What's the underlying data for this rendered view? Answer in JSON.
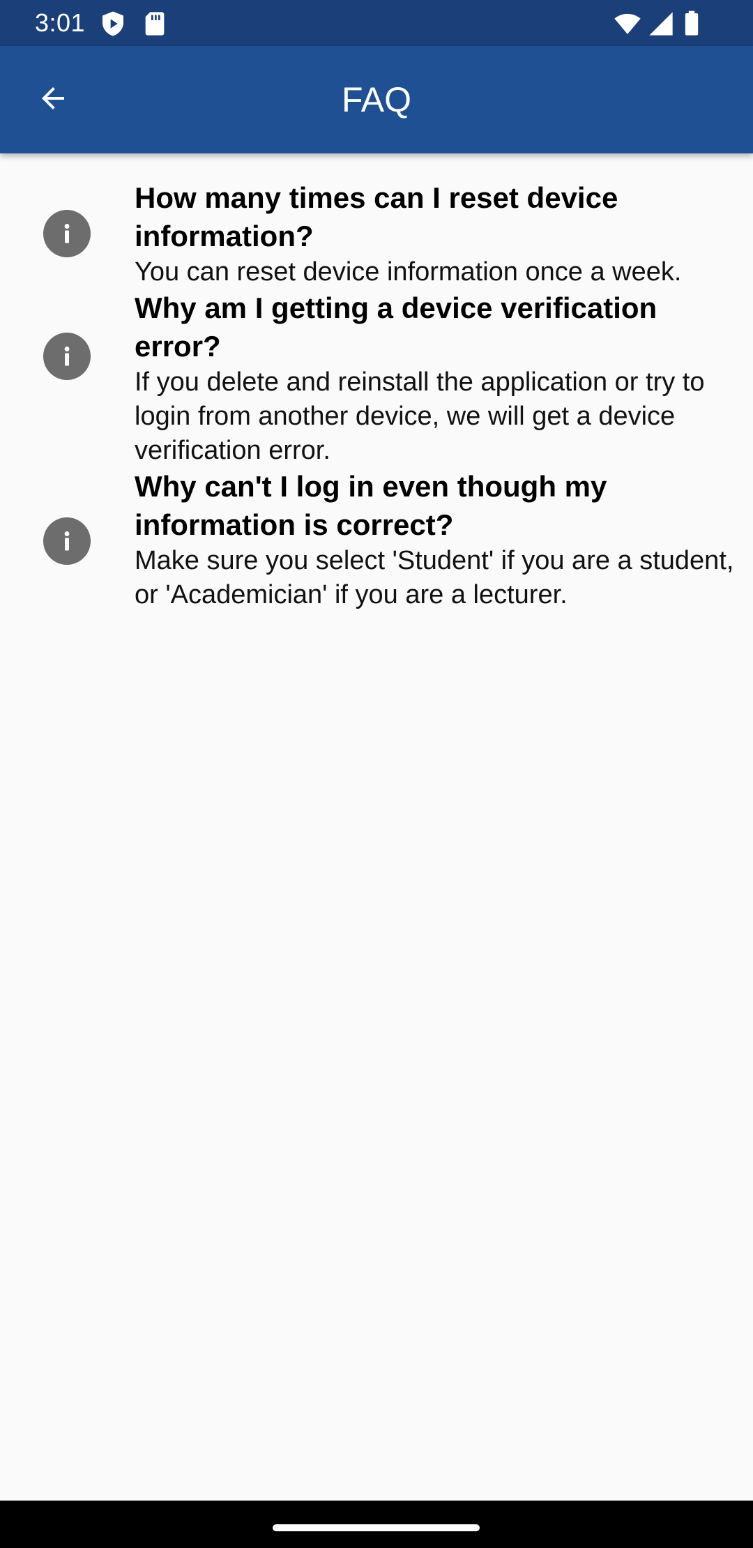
{
  "status_bar": {
    "time": "3:01",
    "left_icons": [
      "shield-play-icon",
      "sd-card-icon"
    ],
    "right_icons": [
      "wifi-icon",
      "cell-signal-icon",
      "battery-icon"
    ]
  },
  "app_bar": {
    "title": "FAQ",
    "back_icon": "arrow-back-icon",
    "color": "#1f5093"
  },
  "faq": [
    {
      "question": "How many times can I reset device information?",
      "answer": "You can reset device information once a week.",
      "icon": "info-icon"
    },
    {
      "question": "Why am I getting a device verification error?",
      "answer": "If you delete and reinstall the application or try to login from another device, we will get a device verification error.",
      "icon": "info-icon"
    },
    {
      "question": "Why can't I log in even though my information is correct?",
      "answer": "Make sure you select 'Student' if you are a student, or 'Academician' if you are a lecturer.",
      "icon": "info-icon"
    }
  ]
}
